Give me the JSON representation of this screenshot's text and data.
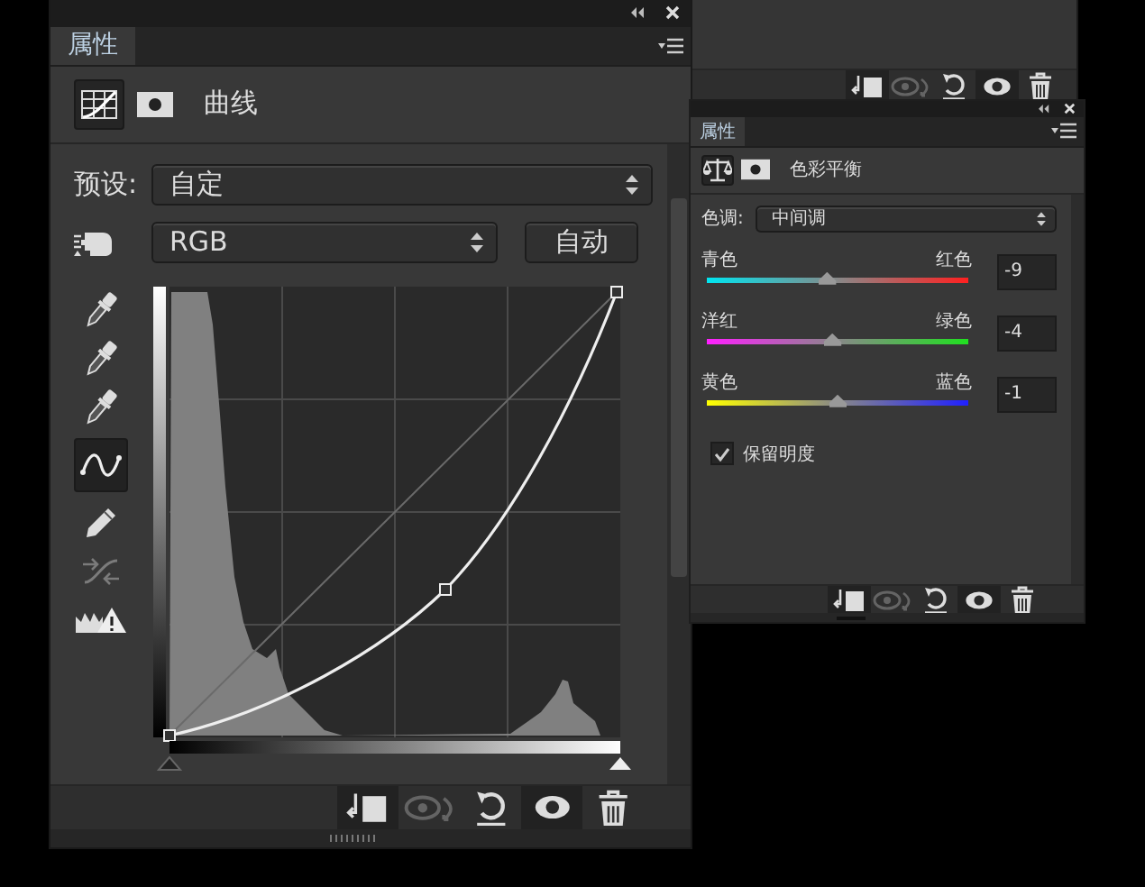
{
  "back_panel": {
    "toolbar": [
      {
        "kind": "clip",
        "selected": true,
        "disabled": false
      },
      {
        "kind": "previous",
        "selected": false,
        "disabled": true
      },
      {
        "kind": "reset",
        "selected": false,
        "disabled": false
      },
      {
        "kind": "eye",
        "selected": true,
        "disabled": false
      },
      {
        "kind": "trash",
        "selected": false,
        "disabled": false
      }
    ]
  },
  "curves_panel": {
    "tab": "属性",
    "title": "曲线",
    "modes": [
      {
        "kind": "curves",
        "selected": true
      },
      {
        "kind": "mask",
        "selected": false
      }
    ],
    "preset": {
      "label": "预设:",
      "value": "自定"
    },
    "channel": {
      "value": "RGB",
      "auto_button": "自动"
    },
    "input_sliders": [
      {
        "level": 0
      },
      {
        "level": 1
      }
    ],
    "tools": [
      {
        "kind": "eyedropper",
        "selected": false,
        "disabled": false
      },
      {
        "kind": "eyedropper",
        "selected": false,
        "disabled": false
      },
      {
        "kind": "eyedropper",
        "selected": false,
        "disabled": false
      },
      {
        "kind": "curve",
        "selected": true,
        "disabled": false
      },
      {
        "kind": "pencil",
        "selected": false,
        "disabled": false
      },
      {
        "kind": "smooth",
        "selected": false,
        "disabled": true
      },
      {
        "kind": "warning",
        "selected": false,
        "disabled": false
      }
    ],
    "toolbar": [
      {
        "kind": "clip",
        "selected": true,
        "disabled": false
      },
      {
        "kind": "previous",
        "selected": false,
        "disabled": true
      },
      {
        "kind": "reset",
        "selected": false,
        "disabled": false
      },
      {
        "kind": "eye",
        "selected": true,
        "disabled": false
      },
      {
        "kind": "trash",
        "selected": false,
        "disabled": false
      }
    ]
  },
  "color_balance_panel": {
    "tab": "属性",
    "title": "色彩平衡",
    "modes": [
      {
        "kind": "balance",
        "selected": true
      },
      {
        "kind": "mask",
        "selected": false
      }
    ],
    "tone": {
      "label": "色调:",
      "value": "中间调"
    },
    "sliders": [
      {
        "left": "青色",
        "right": "红色",
        "level": 0.46,
        "value": "-9"
      },
      {
        "left": "洋红",
        "right": "绿色",
        "level": 0.48,
        "value": "-4"
      },
      {
        "left": "黄色",
        "right": "蓝色",
        "level": 0.5,
        "value": "-1"
      }
    ],
    "preserve": {
      "label": "保留明度",
      "checked": true
    },
    "toolbar": [
      {
        "kind": "clip",
        "selected": true,
        "disabled": false
      },
      {
        "kind": "previous",
        "selected": false,
        "disabled": true
      },
      {
        "kind": "reset",
        "selected": false,
        "disabled": false
      },
      {
        "kind": "eye",
        "selected": true,
        "disabled": false
      },
      {
        "kind": "trash",
        "selected": false,
        "disabled": false
      }
    ]
  }
}
